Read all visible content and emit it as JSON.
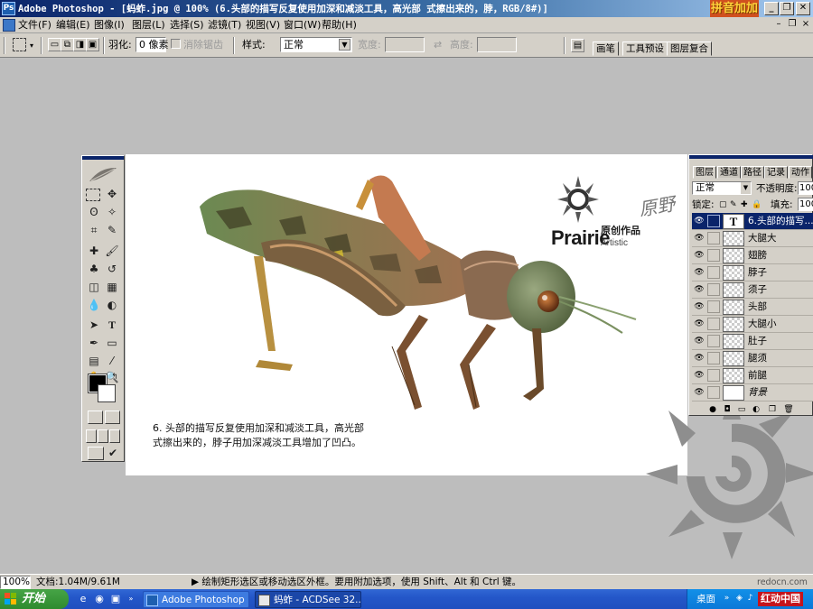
{
  "window": {
    "title": "Adobe Photoshop - [蚂蚱.jpg @ 100% (6.头部的描写反复使用加深和减淡工具，高光部 式擦出来的，脖，RGB/8#)]",
    "watermark": "拼音加加",
    "ps_icon": "Ps",
    "minimize_icon": "minimize-icon",
    "maximize_icon": "restore-icon",
    "close_icon": "close-icon"
  },
  "menu": {
    "items": [
      "文件(F)",
      "编辑(E)",
      "图像(I)",
      "图层(L)",
      "选择(S)",
      "滤镜(T)",
      "视图(V)",
      "窗口(W)",
      "帮助(H)"
    ]
  },
  "options": {
    "feather_label": "羽化:",
    "feather_value": "0 像素",
    "antialias_label": "消除锯齿",
    "style_label": "样式:",
    "style_value": "正常",
    "width_label": "宽度:",
    "height_label": "高度:",
    "palette_tabs": [
      "画笔",
      "工具预设",
      "图层复合"
    ]
  },
  "document": {
    "caption_line1": "6. 头部的描写反复使用加深和减淡工具，高光部",
    "caption_line2": "式擦出来的，脖子用加深减淡工具增加了凹凸。",
    "logo_brand": "Prairie",
    "logo_sub": "Artistic",
    "logo_cn": "原创作品",
    "signature": "原野"
  },
  "layers_panel": {
    "tabs": [
      "图层",
      "通道",
      "路径",
      "记录",
      "动作"
    ],
    "blend_mode": "正常",
    "opacity_label": "不透明度:",
    "opacity_value": "100",
    "lock_label": "锁定:",
    "fill_label": "填充:",
    "fill_value": "100",
    "layers": [
      {
        "name": "6.头部的描写...",
        "type": "text",
        "selected": true
      },
      {
        "name": "大腿大",
        "type": "pixel"
      },
      {
        "name": "翅膀",
        "type": "pixel"
      },
      {
        "name": "脖子",
        "type": "pixel"
      },
      {
        "name": "须子",
        "type": "pixel"
      },
      {
        "name": "头部",
        "type": "pixel"
      },
      {
        "name": "大腿小",
        "type": "pixel"
      },
      {
        "name": "肚子",
        "type": "pixel"
      },
      {
        "name": "腿须",
        "type": "pixel"
      },
      {
        "name": "前腿",
        "type": "pixel"
      },
      {
        "name": "背景",
        "type": "background"
      }
    ]
  },
  "status": {
    "zoom": "100%",
    "doc_info": "文档:1.04M/9.61M",
    "hint": "▶  绘制矩形选区或移动选区外框。要用附加选项，使用 Shift、Alt 和 Ctrl 键。",
    "site": "redocn.com"
  },
  "taskbar": {
    "start_label": "开始",
    "tasks": [
      "Adobe Photoshop ...",
      "蚂蚱 - ACDSee 32..."
    ],
    "desktop_label": "桌面",
    "brand": "红动中国"
  },
  "colors": {
    "titlebar_start": "#0a246a",
    "titlebar_end": "#a6caf0",
    "chrome": "#d4d0c8",
    "workspace": "#bdbdbd",
    "taskbar": "#2457c9",
    "start": "#2e8b2e"
  }
}
